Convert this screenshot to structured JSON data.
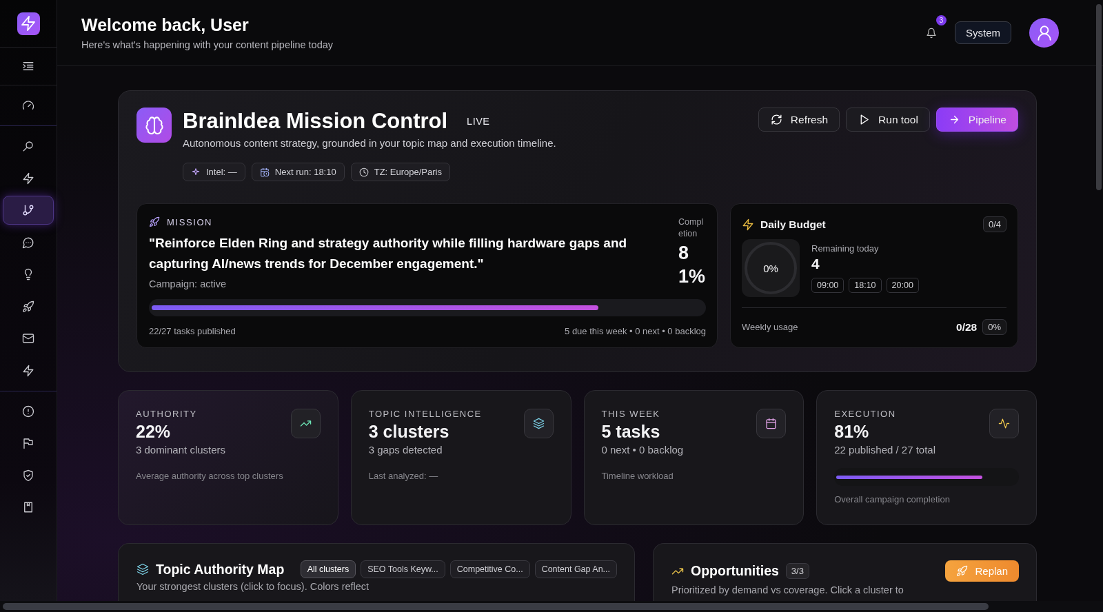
{
  "sidebar": {
    "toggle": {
      "selected": false
    },
    "groups": [
      {
        "items": [
          {
            "selected": false
          }
        ]
      },
      {
        "items": [
          {
            "selected": false
          },
          {
            "selected": false
          },
          {
            "selected": true
          },
          {
            "selected": false
          },
          {
            "selected": false
          },
          {
            "selected": false
          },
          {
            "selected": false
          },
          {
            "selected": false
          }
        ]
      },
      {
        "items": [
          {
            "selected": false
          },
          {
            "selected": false
          },
          {
            "selected": false
          },
          {
            "selected": false
          }
        ]
      }
    ]
  },
  "header": {
    "title": "Welcome back, User",
    "subtitle": "Here's what's happening with your content pipeline today",
    "notification_count": "3",
    "theme_button": "System"
  },
  "hero": {
    "title": "BrainIdea Mission Control",
    "badge": "LIVE",
    "description": "Autonomous content strategy, grounded in your topic map and execution timeline.",
    "chips": [
      {
        "kind": "intel",
        "text": "Intel: —"
      },
      {
        "kind": "schedule",
        "text": "Next run: 18:10"
      },
      {
        "kind": "timezone",
        "text": "TZ: Europe/Paris"
      }
    ],
    "actions": [
      {
        "kind": "refresh",
        "label": "Refresh",
        "primary": false
      },
      {
        "kind": "run",
        "label": "Run tool",
        "primary": false
      },
      {
        "kind": "pipeline",
        "label": "Pipeline",
        "primary": true
      }
    ]
  },
  "mission": {
    "label": "MISSION",
    "quote": "\"Reinforce Elden Ring and strategy authority while filling hardware gaps and capturing AI/news trends for December engagement.\"",
    "status": "Campaign: active",
    "completion_label": "Completion",
    "completion_value": "81%",
    "level": 0.81,
    "tasks": "22/27 tasks published",
    "summary": "5 due this week • 0 next • 0 backlog"
  },
  "budget": {
    "title": "Daily Budget",
    "count": "0/4",
    "ring_text": "0%",
    "remaining_label": "Remaining today",
    "remaining_value": "4",
    "slots": [
      "09:00",
      "18:10",
      "20:00"
    ],
    "weekly_label": "Weekly usage",
    "weekly_value": "0/28",
    "weekly_percent": "0%"
  },
  "stats": [
    {
      "kind": "authority",
      "label": "AUTHORITY",
      "value": "22%",
      "sub": "3 dominant clusters",
      "note": "Average authority across top clusters"
    },
    {
      "kind": "topics",
      "label": "TOPIC INTELLIGENCE",
      "value": "3 clusters",
      "sub": "3 gaps detected",
      "note": "Last analyzed: —"
    },
    {
      "kind": "week",
      "label": "THIS WEEK",
      "value": "5 tasks",
      "sub": "0 next • 0 backlog",
      "note": "Timeline workload"
    },
    {
      "kind": "execution",
      "label": "EXECUTION",
      "value": "81%",
      "sub": "22 published / 27 total",
      "note": "Overall campaign completion",
      "level": 0.81
    }
  ],
  "topic_map": {
    "title": "Topic Authority Map",
    "description": "Your strongest clusters (click to focus). Colors reflect",
    "chips": [
      {
        "text": "All clusters",
        "selected": true
      },
      {
        "text": "SEO Tools Keyw...",
        "selected": false
      },
      {
        "text": "Competitive Co...",
        "selected": false
      },
      {
        "text": "Content Gap An...",
        "selected": false
      }
    ]
  },
  "opportunities": {
    "title": "Opportunities",
    "count": "3/3",
    "description": "Prioritized by demand vs coverage. Click a cluster to",
    "button": "Replan"
  }
}
